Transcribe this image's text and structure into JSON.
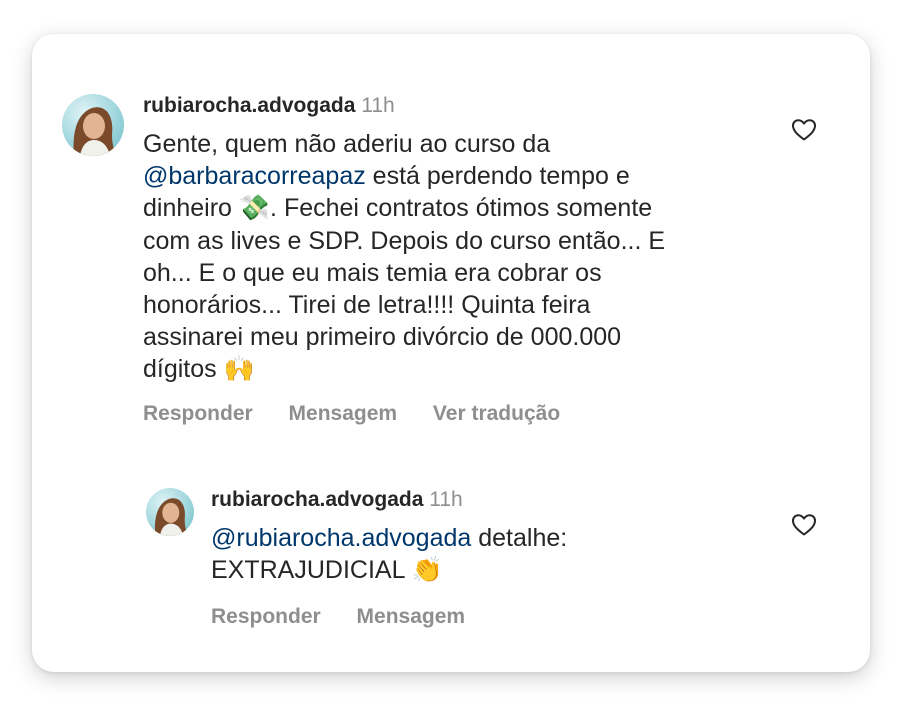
{
  "comment": {
    "username": "rubiarocha.advogada",
    "time": "11h",
    "lines": [
      {
        "before": "Gente, quem não aderiu ao curso da",
        "mention": "",
        "after": ""
      },
      {
        "before": "",
        "mention": "@barbaracorreapaz",
        "after": " está perdendo tempo e"
      },
      {
        "before": "dinheiro ",
        "emoji": "💸",
        "after": ". Fechei contratos ótimos somente"
      },
      {
        "before": "com as lives e SDP. Depois do curso então... E"
      },
      {
        "before": "oh... E o que eu mais temia era cobrar os"
      },
      {
        "before": "honorários... Tirei de letra!!!! Quinta feira"
      },
      {
        "before": "assinarei meu primeiro divórcio de 000.000"
      },
      {
        "before": "dígitos ",
        "emoji": "🙌"
      }
    ],
    "actions": [
      "Responder",
      "Mensagem",
      "Ver tradução"
    ],
    "like_icon": "heart-outline-icon"
  },
  "reply": {
    "username": "rubiarocha.advogada",
    "time": "11h",
    "mention": "@rubiarocha.advogada",
    "text_after_mention": " detalhe:",
    "line2": "EXTRAJUDICIAL ",
    "emoji": "👏",
    "actions": [
      "Responder",
      "Mensagem"
    ],
    "like_icon": "heart-outline-icon"
  },
  "colors": {
    "text": "#262626",
    "secondary": "#8e8e8e",
    "mention": "#00376b"
  }
}
